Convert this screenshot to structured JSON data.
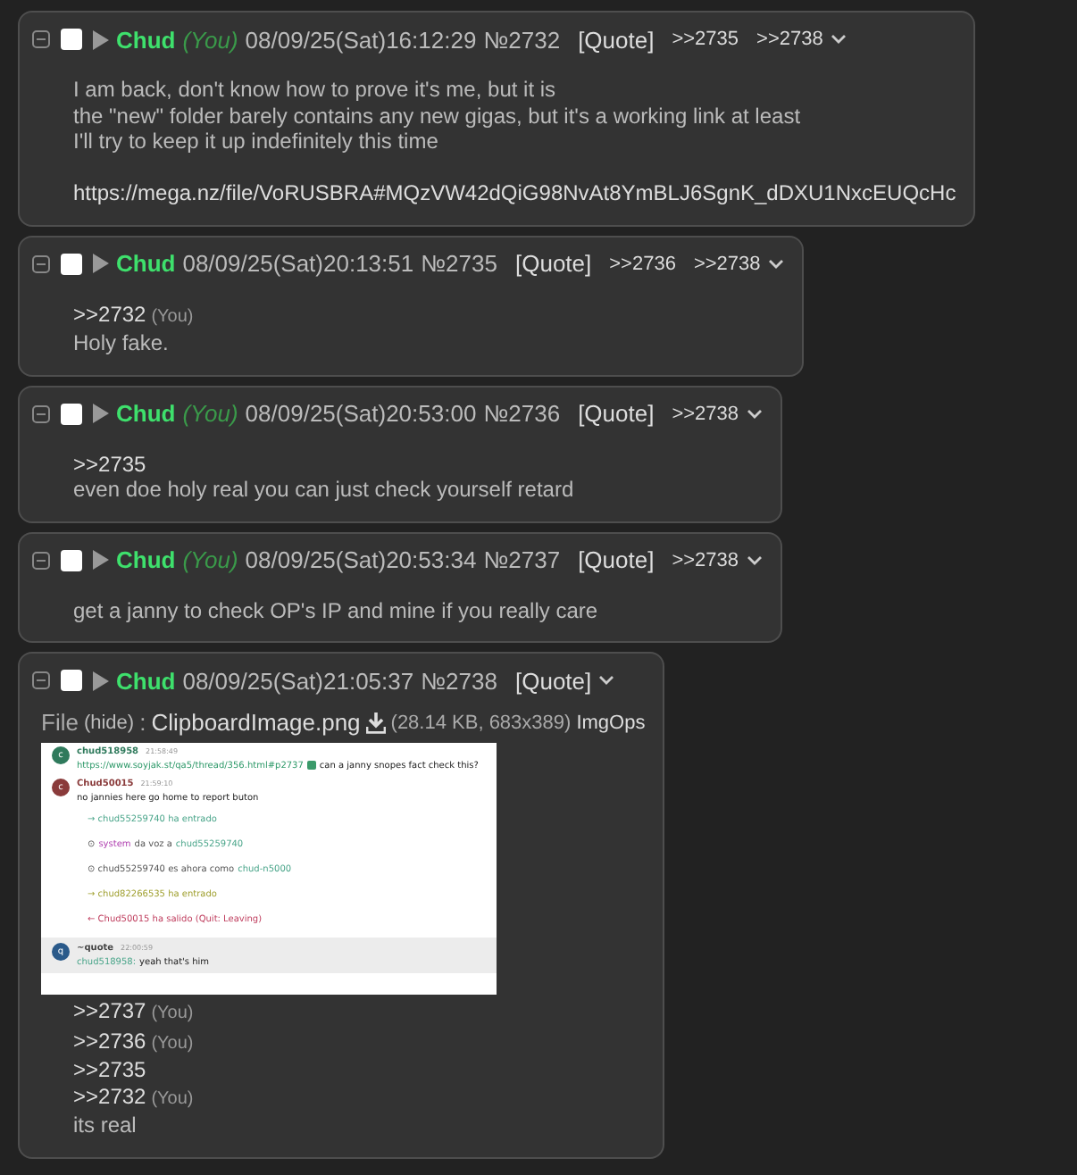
{
  "posts": [
    {
      "name": "Chud",
      "you": "(You)",
      "checked": false,
      "date": "08/09/25(Sat)16:12:29",
      "number": "№2732",
      "quote_label": "[Quote]",
      "backlinks": [
        ">>2735",
        ">>2738"
      ],
      "blocks": [
        {
          "lines": [
            {
              "kind": "text",
              "text": "I am back, don't know how to prove it's me, but it is"
            },
            {
              "kind": "text",
              "text": "the \"new\" folder barely contains any new gigas, but it's a working link at least"
            },
            {
              "kind": "text",
              "text": "I'll try to keep it up indefinitely this time"
            }
          ]
        },
        {
          "lines": [
            {
              "kind": "link",
              "text": "https://mega.nz/file/VoRUSBRA#MQzVW42dQiG98NvAt8YmBLJ6SgnK_dDXU1NxcEUQcHc"
            }
          ]
        }
      ]
    },
    {
      "name": "Chud",
      "checked": false,
      "date": "08/09/25(Sat)20:13:51",
      "number": "№2735",
      "quote_label": "[Quote]",
      "backlinks": [
        ">>2736",
        ">>2738"
      ],
      "blocks": [
        {
          "lines": [
            {
              "kind": "quote",
              "text": ">>2732",
              "you": "(You)"
            },
            {
              "kind": "text",
              "text": "Holy fake."
            }
          ]
        }
      ]
    },
    {
      "name": "Chud",
      "you": "(You)",
      "checked": false,
      "date": "08/09/25(Sat)20:53:00",
      "number": "№2736",
      "quote_label": "[Quote]",
      "backlinks": [
        ">>2738"
      ],
      "blocks": [
        {
          "lines": [
            {
              "kind": "quote",
              "text": ">>2735"
            },
            {
              "kind": "text",
              "text": "even doe holy real you can just check yourself retard"
            }
          ]
        }
      ]
    },
    {
      "name": "Chud",
      "you": "(You)",
      "checked": false,
      "date": "08/09/25(Sat)20:53:34",
      "number": "№2737",
      "quote_label": "[Quote]",
      "backlinks": [
        ">>2738"
      ],
      "blocks": [
        {
          "lines": [
            {
              "kind": "text",
              "text": "get a janny to check OP's IP and mine if you really care"
            }
          ]
        }
      ]
    },
    {
      "name": "Chud",
      "checked": false,
      "date": "08/09/25(Sat)21:05:37",
      "number": "№2738",
      "quote_label": "[Quote]",
      "file": {
        "label": "File",
        "hide": "(hide)",
        "colon": ":",
        "filename": "ClipboardImage.png",
        "meta": "(28.14 KB, 683x389)",
        "imgops": "ImgOps",
        "screenshot": [
          {
            "kind": "message",
            "avatar": "c",
            "color": "#2f7a5c",
            "user": "chud518958",
            "time": "21:58:49",
            "parts": [
              {
                "kind": "link",
                "text": "https://www.soyjak.st/qa5/thread/356.html#p2737"
              },
              {
                "kind": "text",
                "text": "can a janny snopes fact check this?"
              }
            ]
          },
          {
            "kind": "message",
            "avatar": "c",
            "color": "#8a3b3b",
            "user": "Chud50015",
            "time": "21:59:10",
            "parts": [
              {
                "kind": "text",
                "text": "no jannies here go home to report buton"
              }
            ]
          },
          {
            "kind": "event",
            "parts": [
              {
                "kind": "join",
                "text": "→ chud55259740 ha entrado"
              }
            ]
          },
          {
            "kind": "event",
            "parts": [
              {
                "kind": "plain",
                "text": "⊙"
              },
              {
                "kind": "system",
                "text": "system"
              },
              {
                "kind": "plain",
                "text": "da voz a"
              },
              {
                "kind": "nick",
                "text": "chud55259740"
              }
            ]
          },
          {
            "kind": "event",
            "parts": [
              {
                "kind": "plain",
                "text": "⊙ chud55259740 es ahora como"
              },
              {
                "kind": "nick",
                "text": "chud-n5000"
              }
            ]
          },
          {
            "kind": "event",
            "parts": [
              {
                "kind": "join2",
                "text": "→ chud82266535 ha entrado"
              }
            ]
          },
          {
            "kind": "event",
            "parts": [
              {
                "kind": "leave",
                "text": "← Chud50015 ha salido (Quit: Leaving)"
              }
            ]
          },
          {
            "kind": "quote",
            "avatar": "q",
            "color": "#2a5a8a",
            "user": "~quote",
            "time": "22:00:59",
            "parts": [
              {
                "kind": "nick",
                "text": "chud518958:"
              },
              {
                "kind": "text",
                "text": "yeah that's him"
              }
            ]
          }
        ]
      },
      "blocks": [
        {
          "lines": [
            {
              "kind": "quote",
              "text": ">>2737",
              "you": "(You)"
            },
            {
              "kind": "quote",
              "text": ">>2736",
              "you": "(You)"
            },
            {
              "kind": "quote",
              "text": ">>2735"
            },
            {
              "kind": "quote",
              "text": ">>2732",
              "you": "(You)"
            },
            {
              "kind": "text",
              "text": "its real"
            }
          ]
        }
      ]
    }
  ]
}
